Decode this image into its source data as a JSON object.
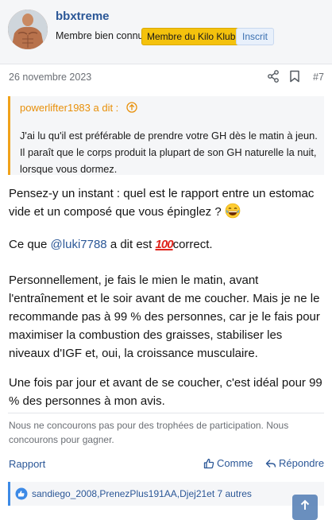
{
  "user": {
    "name": "bbxtreme",
    "title": "Membre bien connu",
    "badges": [
      "Membre du Kilo Klub",
      "Inscrit"
    ]
  },
  "post": {
    "date": "26 novembre 2023",
    "number": "#7"
  },
  "quote": {
    "author": "powerlifter1983 a dit :",
    "text": "J'ai lu qu'il est préférable de prendre votre GH dès le matin à jeun. Il paraît que le corps produit la plupart de son GH naturelle la nuit, lorsque vous dormez."
  },
  "body": {
    "p1": "Pensez-y un instant : quel est le rapport entre un estomac vide et un composé que vous épinglez ?",
    "p2_before": "Ce que ",
    "p2_mention": "@luki7788",
    "p2_middle": " a dit est ",
    "p2_emoji": "100",
    "p2_after": "correct.",
    "p3": "Personnellement, je fais le mien le matin, avant l'entraînement et le soir avant de me coucher. Mais je ne le recommande pas à 99 % des personnes, car je le fais pour maximiser la combustion des graisses, stabiliser les niveaux d'IGF et, oui, la croissance musculaire.",
    "p4": "Une fois par jour et avant de se coucher, c'est idéal pour 99 % des personnes à mon avis."
  },
  "signature": "Nous ne concourons pas pour des trophées de participation. Nous concourons pour gagner.",
  "actions": {
    "report": "Rapport",
    "like": "Comme",
    "reply": "Répondre"
  },
  "reactions": {
    "text": "sandiego_2008,PrenezPlus191AA,Djej21et 7 autres"
  },
  "icons": {
    "share": "share-icon",
    "bookmark": "bookmark-icon",
    "quote_up": "arrow-up-circle-icon",
    "like": "thumbs-up-icon",
    "reply": "reply-arrow-icon",
    "scroll_top": "arrow-up-icon"
  },
  "colors": {
    "accent": "#2b5797",
    "klub_badge": "#f4c20d",
    "quote_border": "#f0a21a",
    "hundred_emoji": "#e0241b"
  }
}
